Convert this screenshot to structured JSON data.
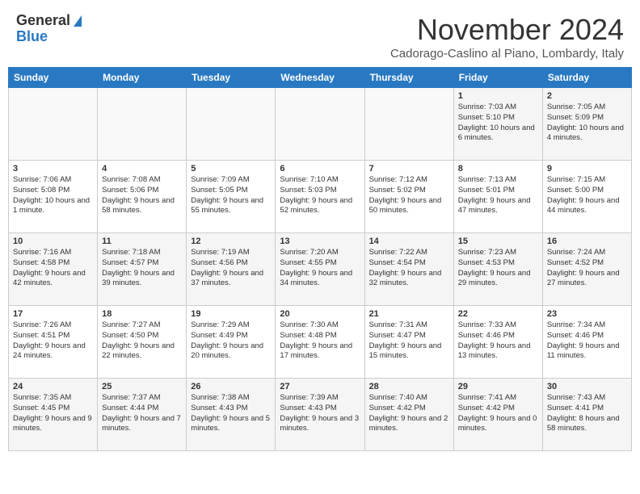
{
  "logo": {
    "general": "General",
    "blue": "Blue"
  },
  "title": "November 2024",
  "subtitle": "Cadorago-Caslino al Piano, Lombardy, Italy",
  "headers": [
    "Sunday",
    "Monday",
    "Tuesday",
    "Wednesday",
    "Thursday",
    "Friday",
    "Saturday"
  ],
  "weeks": [
    [
      {
        "day": "",
        "info": ""
      },
      {
        "day": "",
        "info": ""
      },
      {
        "day": "",
        "info": ""
      },
      {
        "day": "",
        "info": ""
      },
      {
        "day": "",
        "info": ""
      },
      {
        "day": "1",
        "info": "Sunrise: 7:03 AM\nSunset: 5:10 PM\nDaylight: 10 hours and 6 minutes."
      },
      {
        "day": "2",
        "info": "Sunrise: 7:05 AM\nSunset: 5:09 PM\nDaylight: 10 hours and 4 minutes."
      }
    ],
    [
      {
        "day": "3",
        "info": "Sunrise: 7:06 AM\nSunset: 5:08 PM\nDaylight: 10 hours and 1 minute."
      },
      {
        "day": "4",
        "info": "Sunrise: 7:08 AM\nSunset: 5:06 PM\nDaylight: 9 hours and 58 minutes."
      },
      {
        "day": "5",
        "info": "Sunrise: 7:09 AM\nSunset: 5:05 PM\nDaylight: 9 hours and 55 minutes."
      },
      {
        "day": "6",
        "info": "Sunrise: 7:10 AM\nSunset: 5:03 PM\nDaylight: 9 hours and 52 minutes."
      },
      {
        "day": "7",
        "info": "Sunrise: 7:12 AM\nSunset: 5:02 PM\nDaylight: 9 hours and 50 minutes."
      },
      {
        "day": "8",
        "info": "Sunrise: 7:13 AM\nSunset: 5:01 PM\nDaylight: 9 hours and 47 minutes."
      },
      {
        "day": "9",
        "info": "Sunrise: 7:15 AM\nSunset: 5:00 PM\nDaylight: 9 hours and 44 minutes."
      }
    ],
    [
      {
        "day": "10",
        "info": "Sunrise: 7:16 AM\nSunset: 4:58 PM\nDaylight: 9 hours and 42 minutes."
      },
      {
        "day": "11",
        "info": "Sunrise: 7:18 AM\nSunset: 4:57 PM\nDaylight: 9 hours and 39 minutes."
      },
      {
        "day": "12",
        "info": "Sunrise: 7:19 AM\nSunset: 4:56 PM\nDaylight: 9 hours and 37 minutes."
      },
      {
        "day": "13",
        "info": "Sunrise: 7:20 AM\nSunset: 4:55 PM\nDaylight: 9 hours and 34 minutes."
      },
      {
        "day": "14",
        "info": "Sunrise: 7:22 AM\nSunset: 4:54 PM\nDaylight: 9 hours and 32 minutes."
      },
      {
        "day": "15",
        "info": "Sunrise: 7:23 AM\nSunset: 4:53 PM\nDaylight: 9 hours and 29 minutes."
      },
      {
        "day": "16",
        "info": "Sunrise: 7:24 AM\nSunset: 4:52 PM\nDaylight: 9 hours and 27 minutes."
      }
    ],
    [
      {
        "day": "17",
        "info": "Sunrise: 7:26 AM\nSunset: 4:51 PM\nDaylight: 9 hours and 24 minutes."
      },
      {
        "day": "18",
        "info": "Sunrise: 7:27 AM\nSunset: 4:50 PM\nDaylight: 9 hours and 22 minutes."
      },
      {
        "day": "19",
        "info": "Sunrise: 7:29 AM\nSunset: 4:49 PM\nDaylight: 9 hours and 20 minutes."
      },
      {
        "day": "20",
        "info": "Sunrise: 7:30 AM\nSunset: 4:48 PM\nDaylight: 9 hours and 17 minutes."
      },
      {
        "day": "21",
        "info": "Sunrise: 7:31 AM\nSunset: 4:47 PM\nDaylight: 9 hours and 15 minutes."
      },
      {
        "day": "22",
        "info": "Sunrise: 7:33 AM\nSunset: 4:46 PM\nDaylight: 9 hours and 13 minutes."
      },
      {
        "day": "23",
        "info": "Sunrise: 7:34 AM\nSunset: 4:46 PM\nDaylight: 9 hours and 11 minutes."
      }
    ],
    [
      {
        "day": "24",
        "info": "Sunrise: 7:35 AM\nSunset: 4:45 PM\nDaylight: 9 hours and 9 minutes."
      },
      {
        "day": "25",
        "info": "Sunrise: 7:37 AM\nSunset: 4:44 PM\nDaylight: 9 hours and 7 minutes."
      },
      {
        "day": "26",
        "info": "Sunrise: 7:38 AM\nSunset: 4:43 PM\nDaylight: 9 hours and 5 minutes."
      },
      {
        "day": "27",
        "info": "Sunrise: 7:39 AM\nSunset: 4:43 PM\nDaylight: 9 hours and 3 minutes."
      },
      {
        "day": "28",
        "info": "Sunrise: 7:40 AM\nSunset: 4:42 PM\nDaylight: 9 hours and 2 minutes."
      },
      {
        "day": "29",
        "info": "Sunrise: 7:41 AM\nSunset: 4:42 PM\nDaylight: 9 hours and 0 minutes."
      },
      {
        "day": "30",
        "info": "Sunrise: 7:43 AM\nSunset: 4:41 PM\nDaylight: 8 hours and 58 minutes."
      }
    ]
  ]
}
